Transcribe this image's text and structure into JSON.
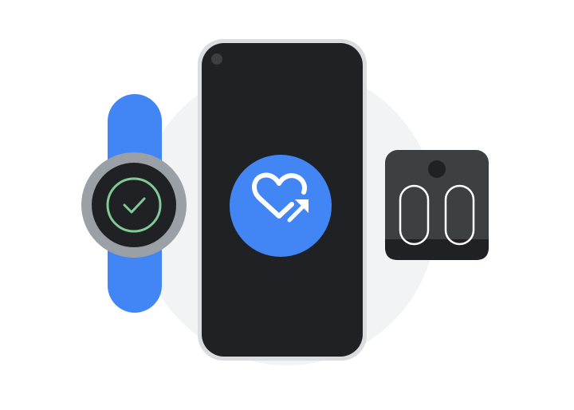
{
  "illustration": {
    "icons": {
      "backdrop": "circle-backdrop",
      "watch": "smartwatch-icon",
      "watch_status": "checkmark-icon",
      "phone": "smartphone-icon",
      "phone_app": "heart-share-icon",
      "tracker": "fitness-tracker-icon"
    },
    "colors": {
      "background": "#ffffff",
      "backdrop": "#f1f3f4",
      "accent_blue": "#4285f4",
      "device_dark": "#202124",
      "device_frame": "#dadce0",
      "watch_bezel": "#9aa0a6",
      "status_green": "#81c995",
      "tracker_body": "#3c4043",
      "white": "#ffffff"
    }
  }
}
